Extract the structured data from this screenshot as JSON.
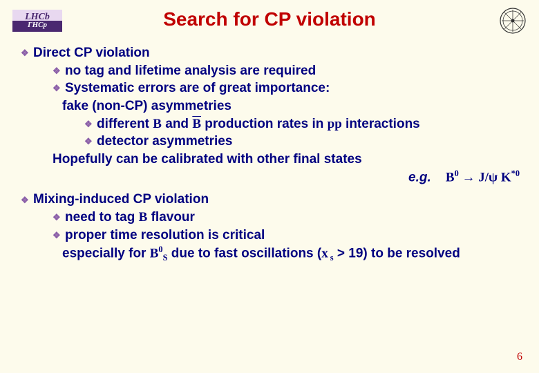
{
  "logo_left": {
    "line1": "LHCb",
    "line2": "ГНСр"
  },
  "title": "Search for CP violation",
  "section1": {
    "heading": "Direct CP violation",
    "b1": "no tag and lifetime analysis are required",
    "b2": "Systematic errors are of great importance:",
    "b3": "fake (non-CP) asymmetries",
    "b4a": "different ",
    "b4b": " and ",
    "b4c": " production rates in ",
    "b4d": " interactions",
    "sym_B": "B",
    "sym_Bbar": "B",
    "sym_pp": "pp",
    "b5": "detector asymmetries",
    "b6": "Hopefully can be calibrated with other final states",
    "eg_label": "e.g.",
    "eg_B0": "B",
    "eg_sup0a": "0",
    "eg_arrow": " → ",
    "eg_Jpsi": "J/ψ",
    "eg_K": " K",
    "eg_star0": "*0"
  },
  "section2": {
    "heading": "Mixing-induced CP violation",
    "b1a": "need to tag ",
    "b1b": " flavour",
    "sym_B": "B",
    "b2": "proper time resolution is critical",
    "b3a": "especially for ",
    "b3_B": "B",
    "b3_sup0": "0",
    "b3_subS": "S",
    "b3b": " due to fast oscillations (",
    "b3_x": "x",
    "b3_subs": " s",
    "b3c": " > 19) to be resolved"
  },
  "page_number": "6"
}
